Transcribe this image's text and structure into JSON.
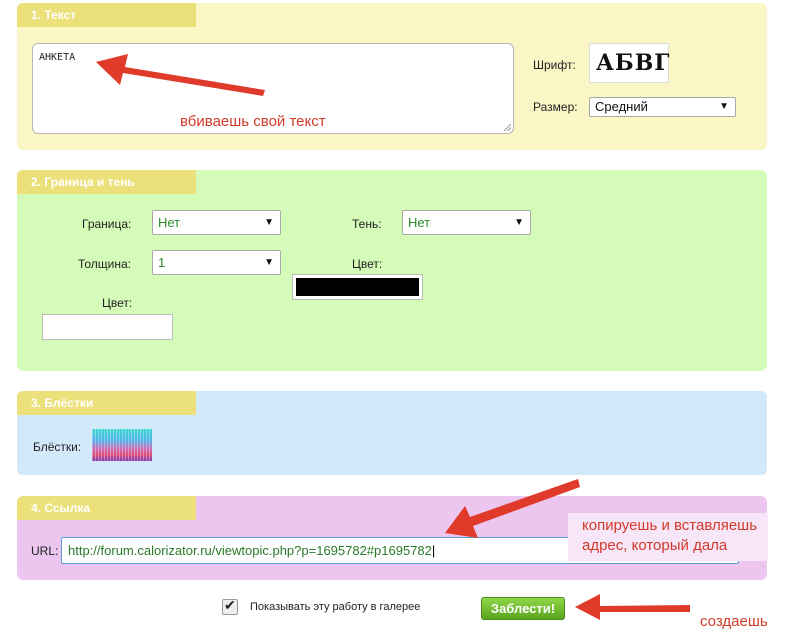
{
  "sections": {
    "text": {
      "title": "1. Текст",
      "textarea_value": "АНКЕТА",
      "font_label": "Шрифт:",
      "font_preview": "АБВГ",
      "size_label": "Размер:",
      "size_value": "Средний"
    },
    "border": {
      "title": "2. Граница и тень",
      "border_label": "Граница:",
      "border_value": "Нет",
      "shadow_label": "Тень:",
      "shadow_value": "Нет",
      "thickness_label": "Толщина:",
      "thickness_value": "1",
      "shadow_color_label": "Цвет:",
      "shadow_color": "#000000",
      "border_color_label": "Цвет:",
      "border_color": "#ffffff"
    },
    "glitter": {
      "title": "3. Блёстки",
      "label": "Блёстки:"
    },
    "link": {
      "title": "4. Ссылка",
      "url_label": "URL:",
      "url_value": "http://forum.calorizator.ru/viewtopic.php?p=1695782#p1695782"
    }
  },
  "footer": {
    "gallery_label": "Показывать эту работу в галерее",
    "submit_label": "Заблести!"
  },
  "annotations": {
    "text_hint": "вбиваешь свой текст",
    "url_hint_line1": "копируешь и вставляешь",
    "url_hint_line2": "адрес, который дала",
    "submit_hint": "создаешь"
  },
  "colors": {
    "arrow": "#e03a2a",
    "section1": "#fbf6c5",
    "section2": "#d4fcb8",
    "section3": "#d2e9fa",
    "section4": "#ecc6ef",
    "tab": "#ece07b",
    "submit_button": "#6fbf2a"
  }
}
